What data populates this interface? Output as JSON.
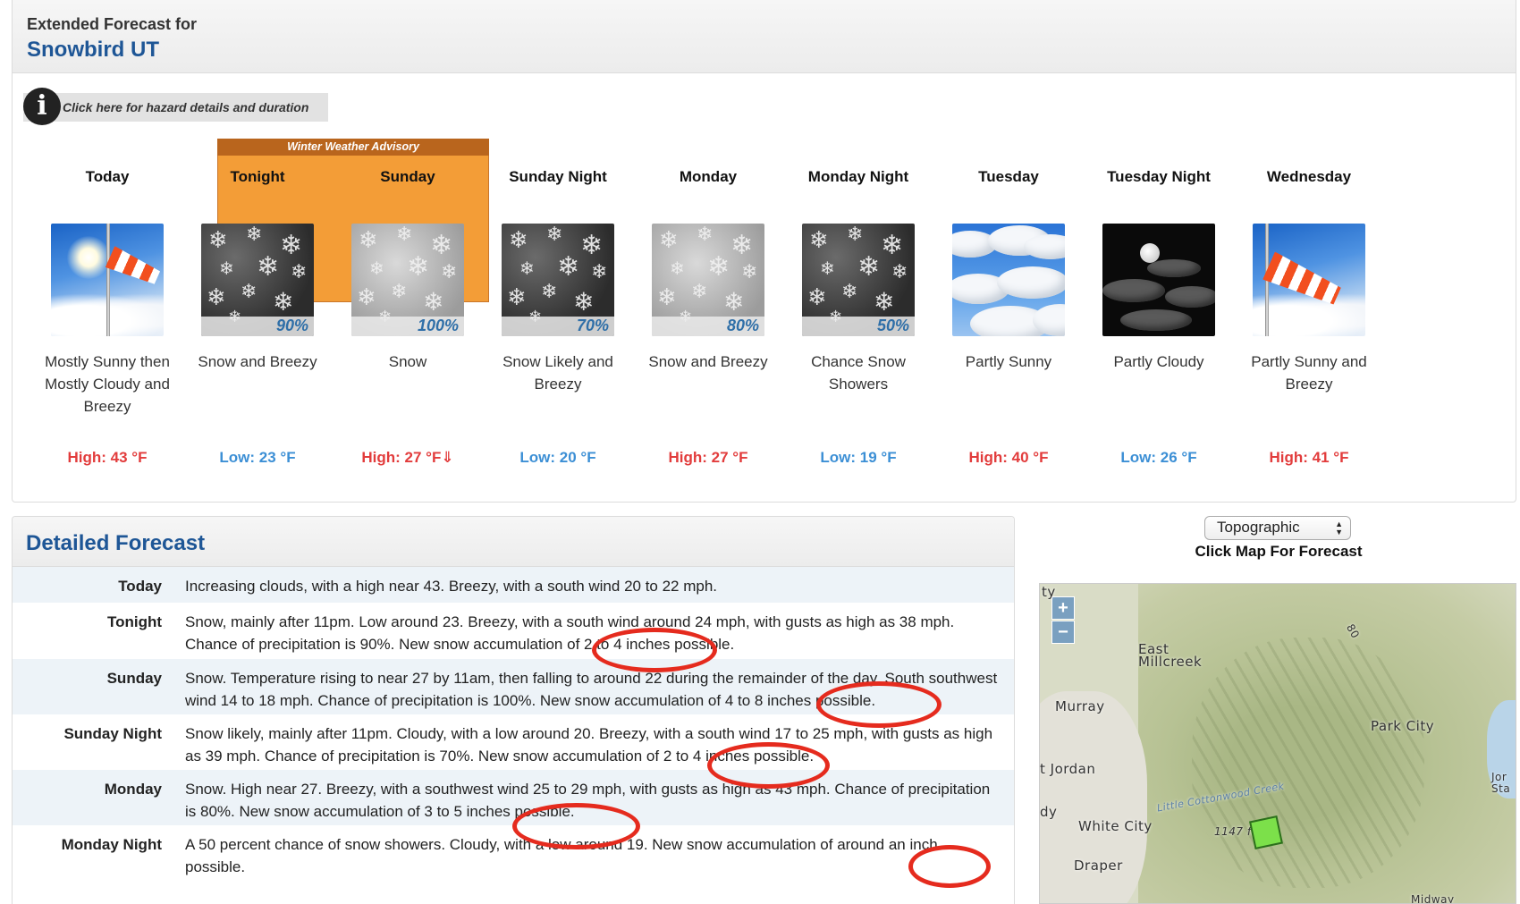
{
  "header": {
    "label": "Extended Forecast for",
    "location": "Snowbird UT"
  },
  "hazard": {
    "link_text": "Click here for hazard details and duration",
    "icon": "info-icon"
  },
  "advisory": {
    "title": "Winter Weather Advisory"
  },
  "periods": [
    {
      "name": "Today",
      "icon": "sunny-windy-icon",
      "pct": "",
      "desc": "Mostly Sunny then Mostly Cloudy and Breezy",
      "temp": "High: 43 °F",
      "kind": "high"
    },
    {
      "name": "Tonight",
      "icon": "snow-night-icon",
      "pct": "90%",
      "desc": "Snow and Breezy",
      "temp": "Low: 23 °F",
      "kind": "low"
    },
    {
      "name": "Sunday",
      "icon": "snow-day-icon",
      "pct": "100%",
      "desc": "Snow",
      "temp": "High: 27 °F⇓",
      "kind": "high"
    },
    {
      "name": "Sunday Night",
      "icon": "snow-night-icon",
      "pct": "70%",
      "desc": "Snow Likely and Breezy",
      "temp": "Low: 20 °F",
      "kind": "low"
    },
    {
      "name": "Monday",
      "icon": "snow-day-icon",
      "pct": "80%",
      "desc": "Snow and Breezy",
      "temp": "High: 27 °F",
      "kind": "high"
    },
    {
      "name": "Monday Night",
      "icon": "snow-night-icon",
      "pct": "50%",
      "desc": "Chance Snow Showers",
      "temp": "Low: 19 °F",
      "kind": "low"
    },
    {
      "name": "Tuesday",
      "icon": "partly-sunny-icon",
      "pct": "",
      "desc": "Partly Sunny",
      "temp": "High: 40 °F",
      "kind": "high"
    },
    {
      "name": "Tuesday Night",
      "icon": "partly-cloudy-night-icon",
      "pct": "",
      "desc": "Partly Cloudy",
      "temp": "Low: 26 °F",
      "kind": "low"
    },
    {
      "name": "Wednesday",
      "icon": "windy-icon",
      "pct": "",
      "desc": "Partly Sunny and Breezy",
      "temp": "High: 41 °F",
      "kind": "high"
    }
  ],
  "detailed": {
    "title": "Detailed Forecast",
    "rows": [
      {
        "label": "Today",
        "text": "Increasing clouds, with a high near 43. Breezy, with a south wind 20 to 22 mph."
      },
      {
        "label": "Tonight",
        "text": "Snow, mainly after 11pm. Low around 23. Breezy, with a south wind around 24 mph, with gusts as high as 38 mph. Chance of precipitation is 90%. New snow accumulation of 2 to 4 inches possible."
      },
      {
        "label": "Sunday",
        "text": "Snow. Temperature rising to near 27 by 11am, then falling to around 22 during the remainder of the day. South southwest wind 14 to 18 mph. Chance of precipitation is 100%. New snow accumulation of 4 to 8 inches possible."
      },
      {
        "label": "Sunday Night",
        "text": "Snow likely, mainly after 11pm. Cloudy, with a low around 20. Breezy, with a south wind 17 to 25 mph, with gusts as high as 39 mph. Chance of precipitation is 70%. New snow accumulation of 2 to 4 inches possible."
      },
      {
        "label": "Monday",
        "text": "Snow. High near 27. Breezy, with a southwest wind 25 to 29 mph, with gusts as high as 43 mph. Chance of precipitation is 80%. New snow accumulation of 3 to 5 inches possible."
      },
      {
        "label": "Monday Night",
        "text": "A 50 percent chance of snow showers. Cloudy, with a low around 19. New snow accumulation of around an inch possible."
      }
    ]
  },
  "map": {
    "select_value": "Topographic",
    "caption": "Click Map For Forecast",
    "zoom_in": "+",
    "zoom_out": "−",
    "labels": [
      "East Millcreek",
      "Murray",
      "Park City",
      "t Jordan",
      "White City",
      "Draper",
      "1147 ft",
      "80",
      "Little Cottonwood Creek",
      "ty",
      "dy",
      "Jor Sta",
      "Midway"
    ]
  },
  "colors": {
    "high": "#e23c3c",
    "low": "#3c8fd5",
    "advisory": "#f39d37",
    "title_blue": "#1e5696",
    "annotation": "#e52b1e"
  }
}
